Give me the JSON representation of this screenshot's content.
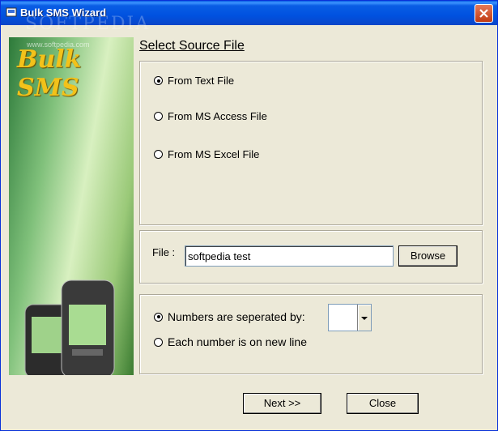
{
  "window": {
    "title": "Bulk SMS Wizard",
    "watermark": "SOFTPEDIA"
  },
  "side_image": {
    "logo_text": "Bulk SMS",
    "url_text": "www.softpedia.com"
  },
  "heading": "Select Source File",
  "source_options": [
    {
      "label": "From Text File",
      "selected": true
    },
    {
      "label": "From MS Access File",
      "selected": false
    },
    {
      "label": "From MS Excel File",
      "selected": false
    }
  ],
  "file": {
    "label": "File :",
    "value": "softpedia test",
    "browse_label": "Browse"
  },
  "number_options": [
    {
      "label": "Numbers are seperated by:",
      "selected": true
    },
    {
      "label": "Each number is on new line",
      "selected": false
    }
  ],
  "separator_combo": {
    "value": ""
  },
  "footer": {
    "next_label": "Next >>",
    "close_label": "Close"
  }
}
